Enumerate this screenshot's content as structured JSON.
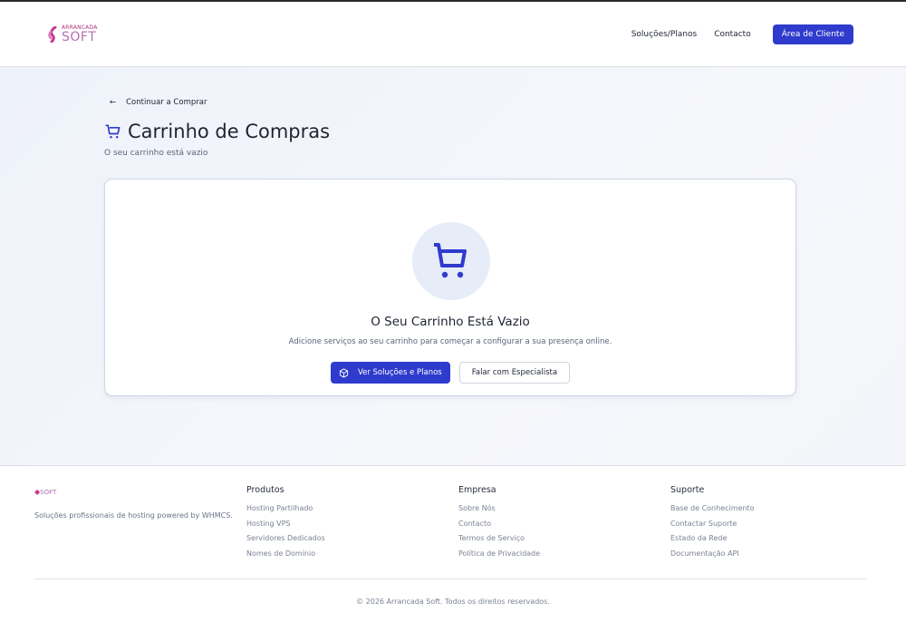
{
  "brand": {
    "name_top": "ARRANCADA",
    "name_bottom": "SOFT"
  },
  "nav": {
    "items": [
      "Soluções/Planos",
      "Contacto"
    ],
    "client_button": "Área de Cliente"
  },
  "page": {
    "back_link": "Continuar a Comprar",
    "title": "Carrinho de Compras",
    "subtitle": "O seu carrinho está vazio"
  },
  "empty": {
    "heading": "O Seu Carrinho Está Vazio",
    "text": "Adicione serviços ao seu carrinho para começar a configurar a sua presença online.",
    "primary_button": "Ver Soluções e Planos",
    "secondary_button": "Falar com Especialista"
  },
  "footer": {
    "description": "Soluções profissionais de hosting powered by WHMCS.",
    "columns": [
      {
        "title": "Produtos",
        "links": [
          "Hosting Partilhado",
          "Hosting VPS",
          "Servidores Dedicados",
          "Nomes de Domínio"
        ]
      },
      {
        "title": "Empresa",
        "links": [
          "Sobre Nós",
          "Contacto",
          "Termos de Serviço",
          "Política de Privacidade"
        ]
      },
      {
        "title": "Suporte",
        "links": [
          "Base de Conhecimento",
          "Contactar Suporte",
          "Estado da Rede",
          "Documentação API"
        ]
      }
    ],
    "copyright": "© 2026 Arrancada Soft. Todos os direitos reservados."
  },
  "colors": {
    "accent": "#2f3bcc",
    "brand": "#b0307e"
  }
}
